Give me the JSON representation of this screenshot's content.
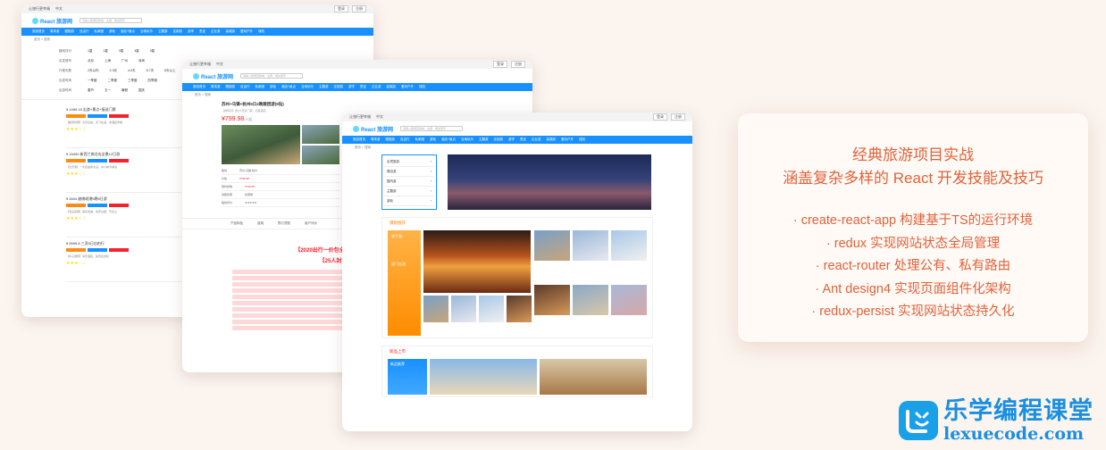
{
  "window": {
    "topbar_left": "让旅行更幸福",
    "topbar_lang": "中文",
    "login": "登录",
    "register": "注册",
    "logo": "React 旅游网",
    "search_placeholder": "请输入旅游目的地、主题、或关键字",
    "nav_items": [
      "旅游首页",
      "周末游",
      "跟团游",
      "自由行",
      "私家团",
      "游轮",
      "酒店+景点",
      "当地玩乐",
      "主题游",
      "定制游",
      "游学",
      "签证",
      "企业游",
      "高端游",
      "爱玩户外",
      "保险"
    ],
    "crumb": "首页 > 搜索"
  },
  "list_page": {
    "filters": [
      {
        "label": "路线评分",
        "opts": [
          "1星",
          "2星",
          "3星",
          "4星",
          "5星"
        ]
      },
      {
        "label": "出发城市",
        "opts": [
          "北京",
          "上海",
          "广州",
          "深圳"
        ]
      },
      {
        "label": "行程天数",
        "opts": [
          "2天以内",
          "2-3天",
          "4-5天",
          "6-7天",
          "8天以上"
        ]
      },
      {
        "label": "出发时间",
        "opts": [
          "一季度",
          "二季度",
          "三季度",
          "四季度"
        ]
      },
      {
        "label": "出游时间",
        "opts": [
          "春节",
          "五一",
          "暑假",
          "国庆"
        ]
      }
    ],
    "products": [
      {
        "title": "¥ 1499.15 出游+景点+接送门票",
        "price": "¥ 1499.15",
        "desc": "【超值特惠】北京出发，双飞往返，含酒店早餐"
      },
      {
        "title": "¥ 15490 新西兰南北岛全景12日游",
        "price": "¥ 15490",
        "desc": "【全景游】一次走遍南北岛，冰川峡湾湖泊"
      },
      {
        "title": "¥ 4544 越南岘港5晚6日游",
        "price": "¥ 4544",
        "desc": "【海岛度假】美溪海滩，会安古镇，巴拿山"
      },
      {
        "title": "¥ 5999.8 三亚5日自由行",
        "price": "¥ 5999.8",
        "desc": "【亲子推荐】海景酒店，免费接送机"
      }
    ]
  },
  "detail_page": {
    "title": "苏州+乌镇+杭州5日4晚跟团游(5钻)",
    "subtitle": "【鲜纯玩】含5大景区门票，四星酒店",
    "price": "¥799.98",
    "price_unit": "/人起",
    "table": [
      {
        "k": "路线",
        "v": "苏州-乌镇-杭州"
      },
      {
        "k": "价格",
        "v": "¥799.98"
      },
      {
        "k": "限时抢购",
        "v": "¥799.98"
      },
      {
        "k": "领取优惠",
        "v": "优惠券"
      },
      {
        "k": "路线评价",
        "v": "★★★★★"
      }
    ],
    "tabs": [
      "产品特色",
      "费用",
      "预订须知",
      "用户评价"
    ],
    "promo_line1": "【2020出行一价包全含】升级版：浙东五星尊享之旅",
    "promo_line2": "【25人封顶小团】增加游览时间"
  },
  "home_page": {
    "menu": [
      "出境旅游",
      "周边游",
      "国内游",
      "主题游",
      "游轮"
    ],
    "recommend_title": "爆款推荐",
    "promo_text": "来个游",
    "promo_text2": "厦门出游",
    "new_title": "新品上市",
    "new_promo": "新品推荐"
  },
  "info_card": {
    "heading1": "经典旅游项目实战",
    "heading2": "涵盖复杂多样的 React 开发技能及技巧",
    "bullets": [
      "· create-react-app 构建基于TS的运行环境",
      "· redux 实现网站状态全局管理",
      "· react-router 处理公有、私有路由",
      "· Ant design4 实现页面组件化架构",
      "· redux-persist 实现网站状态持久化"
    ]
  },
  "brand": {
    "name": "乐学编程课堂",
    "domain": "lexuecode.com"
  },
  "colors": {
    "accent": "#e0623a",
    "nav_blue": "#1890ff",
    "brand_blue": "#1a8fe0",
    "background": "#fbf4ef"
  }
}
